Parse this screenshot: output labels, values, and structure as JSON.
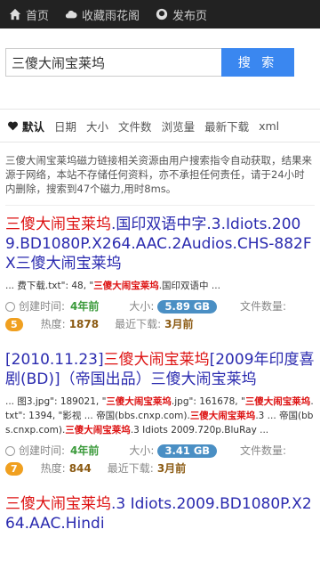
{
  "nav": {
    "home": "首页",
    "favorites": "收藏雨花阁",
    "publish": "发布页"
  },
  "search": {
    "value": "三傻大闹宝莱坞",
    "button": "搜 索"
  },
  "tabs": [
    "默认",
    "日期",
    "大小",
    "文件数",
    "浏览量",
    "最新下载",
    "xml"
  ],
  "notice": "三傻大闹宝莱坞磁力链接相关资源由用户搜索指令自动获取，结果来源于网络，本站不存储任何资料，亦不承担任何责任，请于24小时内删除，搜索到47个磁力,用时8ms。",
  "labels": {
    "created": "创建时间:",
    "size": "大小:",
    "file_count": "文件数量:",
    "heat": "热度:",
    "last_download": "最近下载:"
  },
  "results": [
    {
      "title_hl": "三傻大闹宝莱坞",
      "title_rest": ".国印双语中字.3.Idiots.2009.BD1080P.X264.AAC.2Audios.CHS-882FX",
      "title_hl2": "三傻大闹宝莱坞",
      "snippet_pre": "... 费下载.txt\": 48, \"",
      "snippet_hl": "三傻大闹宝莱坞",
      "snippet_post": ".国印双语中 ...",
      "created": "4年前",
      "size": "5.89 GB",
      "file_count": "5",
      "heat": "1878",
      "last_download": "3月前"
    },
    {
      "title_pre": "[2010.11.23]",
      "title_hl": "三傻大闹宝莱坞",
      "title_rest": "[2009年印度喜剧(BD)]（帝国出品）",
      "title_hl2": "三傻大闹宝莱坞",
      "snippet_1": "... 图3.jpg\": 189021, \"",
      "snippet_hl1": "三傻大闹宝莱坞",
      "snippet_2": ".jpg\": 161678, \"",
      "snippet_hl2": "三傻大闹宝莱坞",
      "snippet_3": ".txt\": 1394, \"影视 ... 帝国(bbs.cnxp.com).",
      "snippet_hl3": "三傻大闹宝莱坞",
      "snippet_4": ".3 ... 帝国(bbs.cnxp.com).",
      "snippet_hl4": "三傻大闹宝莱坞",
      "snippet_5": ".3 Idiots 2009.720p.BluRay ...",
      "created": "4年前",
      "size": "3.41 GB",
      "file_count": "7",
      "heat": "844",
      "last_download": "3月前"
    },
    {
      "title_hl": "三傻大闹宝莱坞",
      "title_rest": ".3 Idiots.2009.BD1080P.X264.AAC.Hindi"
    }
  ]
}
